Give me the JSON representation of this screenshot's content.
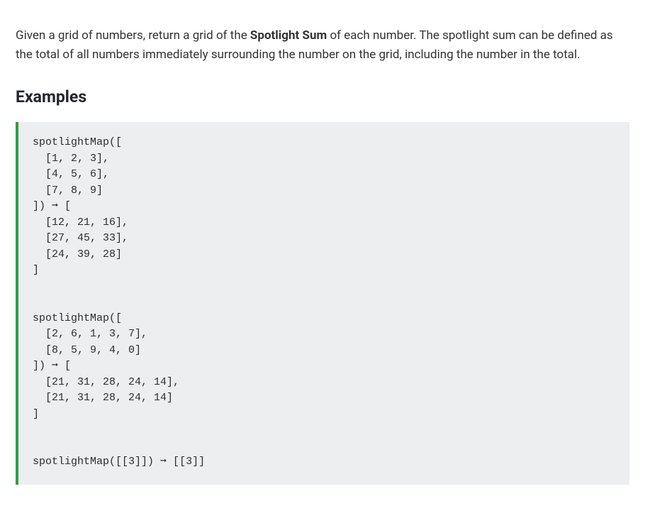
{
  "description": {
    "pre": "Given a grid of numbers, return a grid of the ",
    "bold": "Spotlight Sum",
    "post": " of each number. The spotlight sum can be defined as the total of all numbers immediately surrounding the number on the grid, including the number in the total."
  },
  "examples_heading": "Examples",
  "code": "spotlightMap([\n  [1, 2, 3],\n  [4, 5, 6],\n  [7, 8, 9]\n]) ➞ [\n  [12, 21, 16],\n  [27, 45, 33],\n  [24, 39, 28]\n]\n\n\nspotlightMap([\n  [2, 6, 1, 3, 7],\n  [8, 5, 9, 4, 0]\n]) ➞ [\n  [21, 31, 28, 24, 14],\n  [21, 31, 28, 24, 14]\n]\n\n\nspotlightMap([[3]]) ➞ [[3]]"
}
